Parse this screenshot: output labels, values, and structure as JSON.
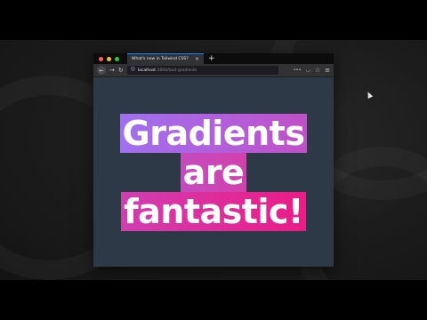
{
  "browser": {
    "tab_title": "What's new in Tailwind CSS?",
    "url_host": "localhost",
    "url_path": ":3000/text-gradients"
  },
  "content": {
    "line1": "Gradients",
    "line2": "are",
    "line3": "fantastic!"
  },
  "colors": {
    "gradient_start": "#a070f0",
    "gradient_end": "#ec1b87",
    "page_bg": "#2d3947"
  },
  "icons": [
    "back-arrow-icon",
    "forward-arrow-icon",
    "reload-icon",
    "page-info-icon",
    "pocket-icon",
    "bookmark-star-icon",
    "menu-icon",
    "close-icon",
    "new-tab-icon"
  ]
}
